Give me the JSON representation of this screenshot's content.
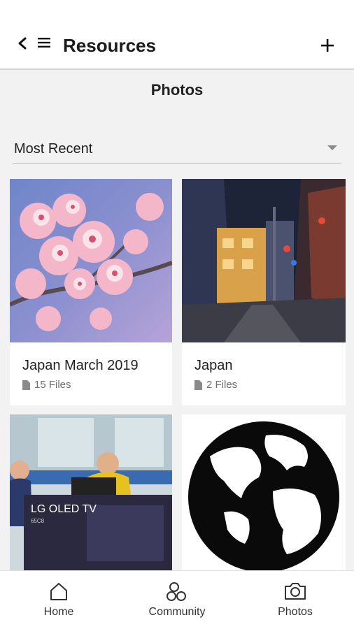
{
  "header": {
    "title": "Resources"
  },
  "section": {
    "title": "Photos"
  },
  "sort": {
    "selected": "Most Recent"
  },
  "cards": [
    {
      "title": "Japan March 2019",
      "meta": "15 Files",
      "image": "cherry-blossom-photo"
    },
    {
      "title": "Japan",
      "meta": "2 Files",
      "image": "japan-street-night-photo"
    },
    {
      "title": "",
      "meta": "",
      "image": "lg-oled-tv-event-photo"
    },
    {
      "title": "",
      "meta": "",
      "image": "globe-photo"
    }
  ],
  "tabs": [
    {
      "label": "Home",
      "icon": "home-icon"
    },
    {
      "label": "Community",
      "icon": "community-icon"
    },
    {
      "label": "Photos",
      "icon": "camera-icon"
    }
  ],
  "colors": {
    "accent": "#222222",
    "background": "#f2f2f2",
    "header_bg": "#ffffff"
  }
}
